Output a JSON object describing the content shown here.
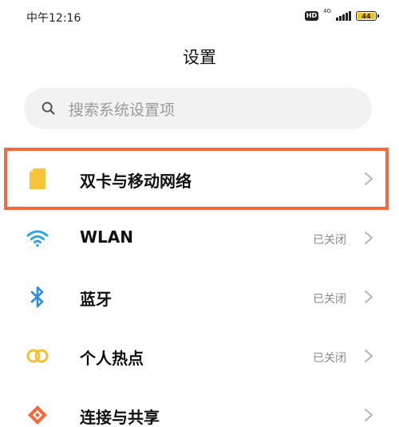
{
  "status_bar": {
    "time": "中午12:16",
    "hd": "HD",
    "network": "4G",
    "battery_level": "44",
    "battery_color": "#f0c419"
  },
  "header": {
    "title": "设置"
  },
  "search": {
    "placeholder": "搜索系统设置项",
    "icon": "search-icon"
  },
  "settings_list": [
    {
      "label": "双卡与移动网络",
      "status": "",
      "icon": "sim-card-icon",
      "icon_color": "#f5c43a",
      "highlighted": true
    },
    {
      "label": "WLAN",
      "status": "已关闭",
      "icon": "wifi-icon",
      "icon_color": "#2aa7e8"
    },
    {
      "label": "蓝牙",
      "status": "已关闭",
      "icon": "bluetooth-icon",
      "icon_color": "#2a8be8"
    },
    {
      "label": "个人热点",
      "status": "已关闭",
      "icon": "hotspot-icon",
      "icon_color": "#f2c230"
    },
    {
      "label": "连接与共享",
      "status": "",
      "icon": "connection-share-icon",
      "icon_color": "#f26a3d"
    }
  ],
  "highlight_color": "#f26a3d"
}
